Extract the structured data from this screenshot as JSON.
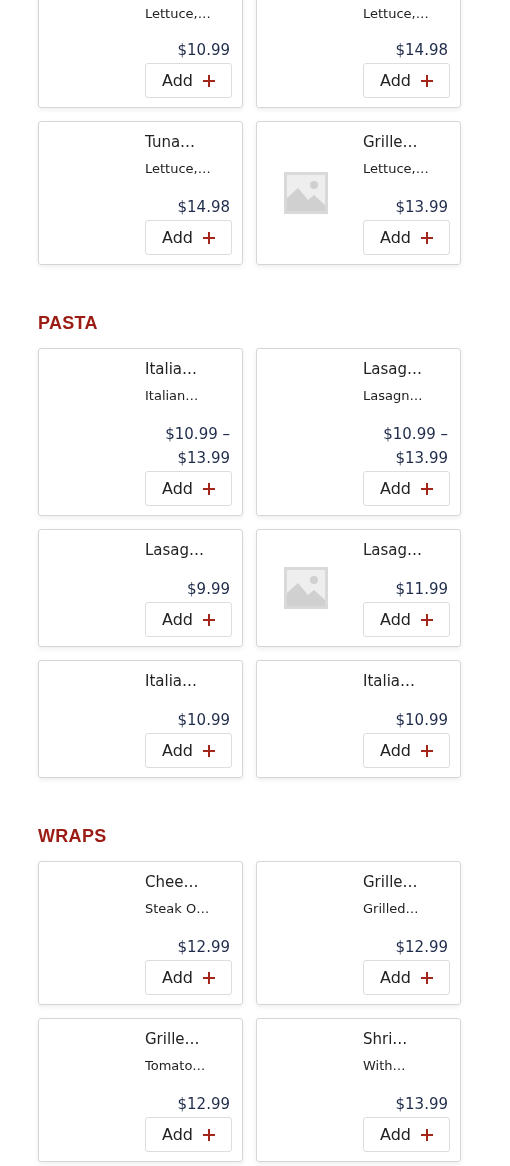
{
  "sections": [
    {
      "items": [
        {
          "description": "Lettuce,…",
          "price": "$10.99",
          "button": "Add",
          "image": false
        },
        {
          "description": "Lettuce,…",
          "price": "$14.98",
          "button": "Add",
          "image": false
        },
        {
          "title": "Tuna…",
          "description": "Lettuce,…",
          "price": "$14.98",
          "button": "Add",
          "image": false
        },
        {
          "title": "Grille…",
          "description": "Lettuce,…",
          "price": "$13.99",
          "button": "Add",
          "image": true
        }
      ]
    },
    {
      "heading": "PASTA",
      "items": [
        {
          "title": "Italia…",
          "description": "Italian…",
          "price": "$10.99 – $13.99",
          "button": "Add",
          "image": false
        },
        {
          "title": "Lasag…",
          "description": "Lasagn…",
          "price": "$10.99 – $13.99",
          "button": "Add",
          "image": false
        },
        {
          "title": "Lasag…",
          "price": "$9.99",
          "button": "Add",
          "image": false
        },
        {
          "title": "Lasag…",
          "price": "$11.99",
          "button": "Add",
          "image": true
        },
        {
          "title": "Italia…",
          "price": "$10.99",
          "button": "Add",
          "image": false
        },
        {
          "title": "Italia…",
          "price": "$10.99",
          "button": "Add",
          "image": false
        }
      ]
    },
    {
      "heading": "WRAPS",
      "items": [
        {
          "title": "Chee…",
          "description": "Steak O…",
          "price": "$12.99",
          "button": "Add",
          "image": false
        },
        {
          "title": "Grille…",
          "description": "Grilled…",
          "price": "$12.99",
          "button": "Add",
          "image": false
        },
        {
          "title": "Grille…",
          "description": "Tomato…",
          "price": "$12.99",
          "button": "Add",
          "image": false
        },
        {
          "title": "Shri…",
          "description": "With…",
          "price": "$13.99",
          "button": "Add",
          "image": false
        }
      ]
    }
  ]
}
